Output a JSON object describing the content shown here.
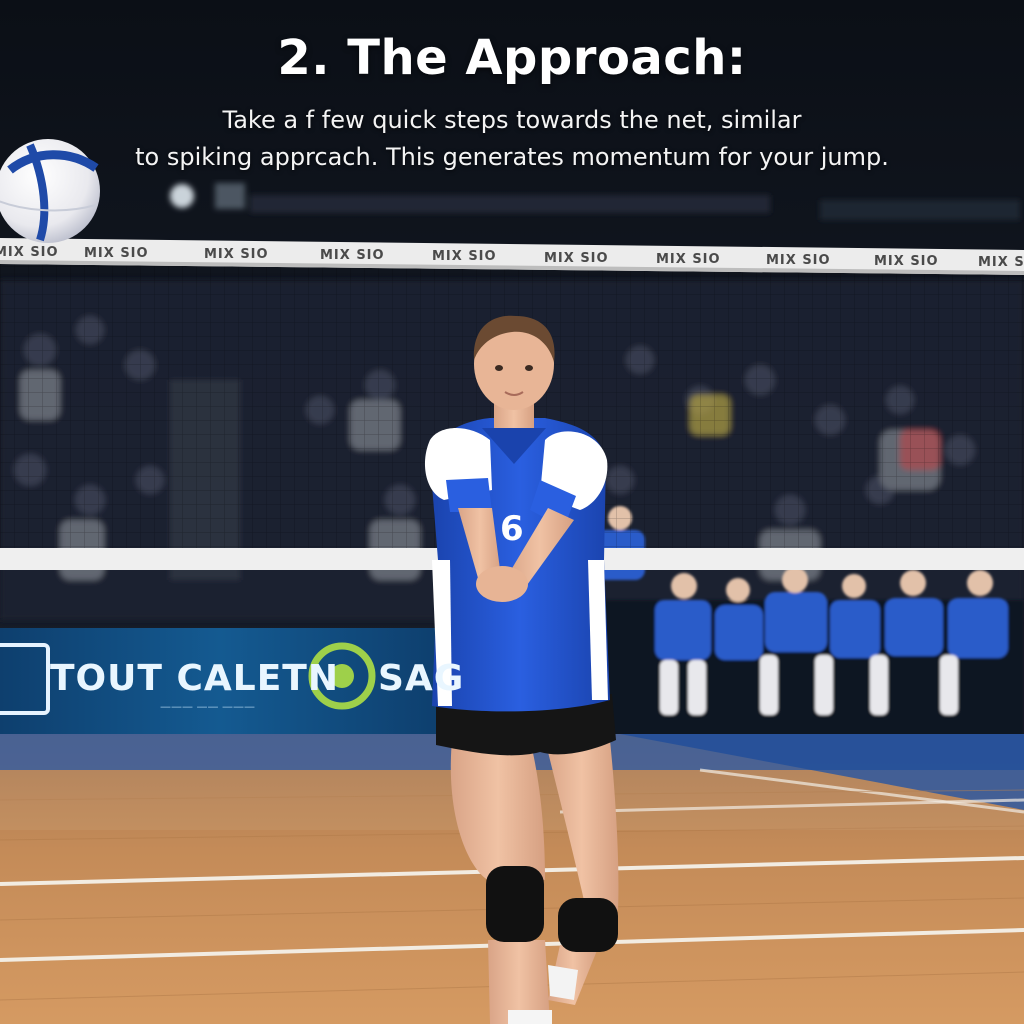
{
  "overlay": {
    "title": "2. The Approach:",
    "caption_line1": "Take a f few quick steps towards the net, similar",
    "caption_line2": "to spiking apprcach. This generates momentum for your jump."
  },
  "net": {
    "sponsor_text": "MIX SIO"
  },
  "banner": {
    "main_text": "TOUT CALETN",
    "trailing_text": "SAG",
    "sub_text": "——— —— ———"
  },
  "player": {
    "jersey_number": "6"
  },
  "colors": {
    "jersey_blue": "#1f4fc4",
    "court_wood": "#c98f5c",
    "banner_blue": "#0f4f86",
    "net_band": "#ececec"
  }
}
